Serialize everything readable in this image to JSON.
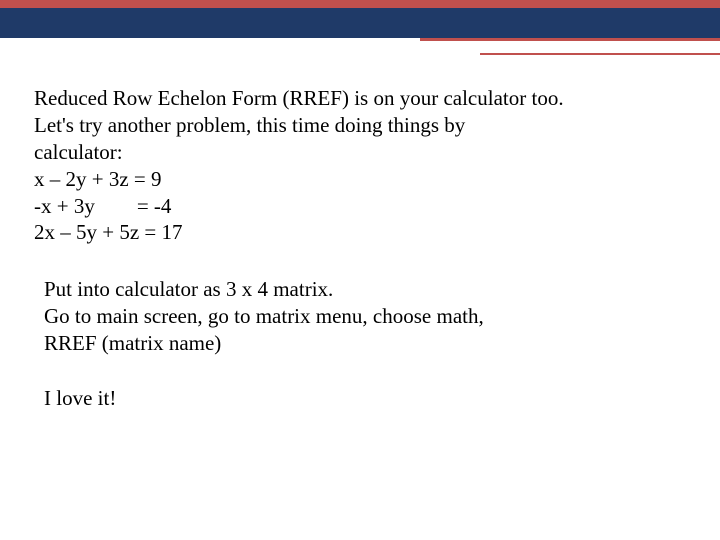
{
  "intro": {
    "line1": "Reduced Row Echelon Form (RREF) is on your calculator too.",
    "line2": "Let's try another problem, this time doing things by",
    "line3": "calculator:",
    "eq1": "x – 2y + 3z = 9",
    "eq2": "-x + 3y        = -4",
    "eq3": "2x – 5y + 5z = 17"
  },
  "instructions": {
    "line1": "Put into calculator as 3 x 4 matrix.",
    "line2": "Go to main screen, go to matrix menu, choose math,",
    "line3": "RREF (matrix name)"
  },
  "closing": "I love it!"
}
